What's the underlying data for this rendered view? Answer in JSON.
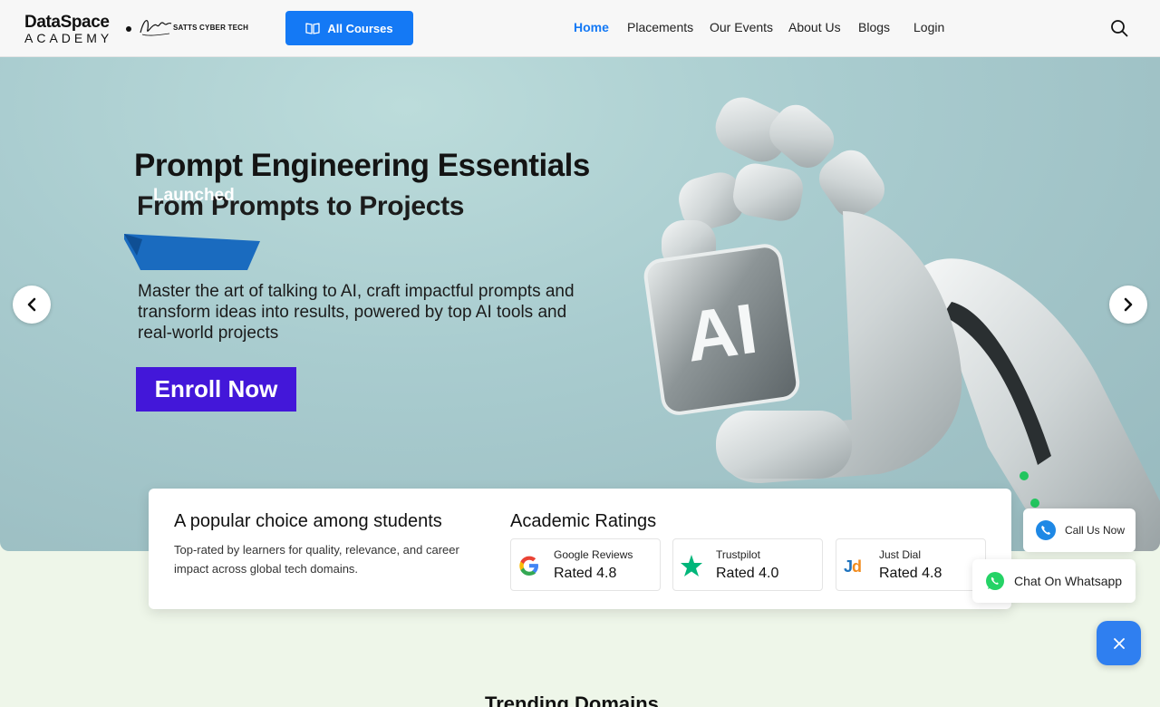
{
  "header": {
    "logo_top": "DataSpace",
    "logo_bottom": "ACADEMY",
    "partner_name": "SATTS CYBER TECH",
    "all_courses_label": "All Courses",
    "nav": [
      {
        "label": "Home",
        "active": true
      },
      {
        "label": "Placements",
        "active": false
      },
      {
        "label": "Our Events",
        "active": false
      },
      {
        "label": "About Us",
        "active": false
      },
      {
        "label": "Blogs",
        "active": false
      },
      {
        "label": "Login",
        "active": false
      }
    ]
  },
  "hero": {
    "title": "Prompt Engineering Essentials",
    "subtitle": "From Prompts to Projects",
    "badge": "Launched",
    "description": "Master the art of talking to AI, craft impactful prompts and transform ideas into results, powered by top AI tools and real-world projects",
    "cta": "Enroll Now",
    "robot_chip_text": "AI"
  },
  "popular": {
    "title": "A popular choice among students",
    "description": "Top-rated by learners for quality, relevance, and career impact across global tech domains."
  },
  "ratings": {
    "title": "Academic Ratings",
    "items": [
      {
        "source": "Google Reviews",
        "value": "Rated 4.8",
        "icon": "google-icon"
      },
      {
        "source": "Trustpilot",
        "value": "Rated 4.0",
        "icon": "star-icon"
      },
      {
        "source": "Just Dial",
        "value": "Rated 4.8",
        "icon": "justdial-icon"
      }
    ]
  },
  "contact": {
    "call_label": "Call Us Now",
    "whatsapp_label": "Chat On Whatsapp"
  },
  "section": {
    "trending_title": "Trending Domains"
  },
  "colors": {
    "accent": "#1479f5",
    "cta": "#4317d9",
    "badge": "#1a6bbf"
  }
}
